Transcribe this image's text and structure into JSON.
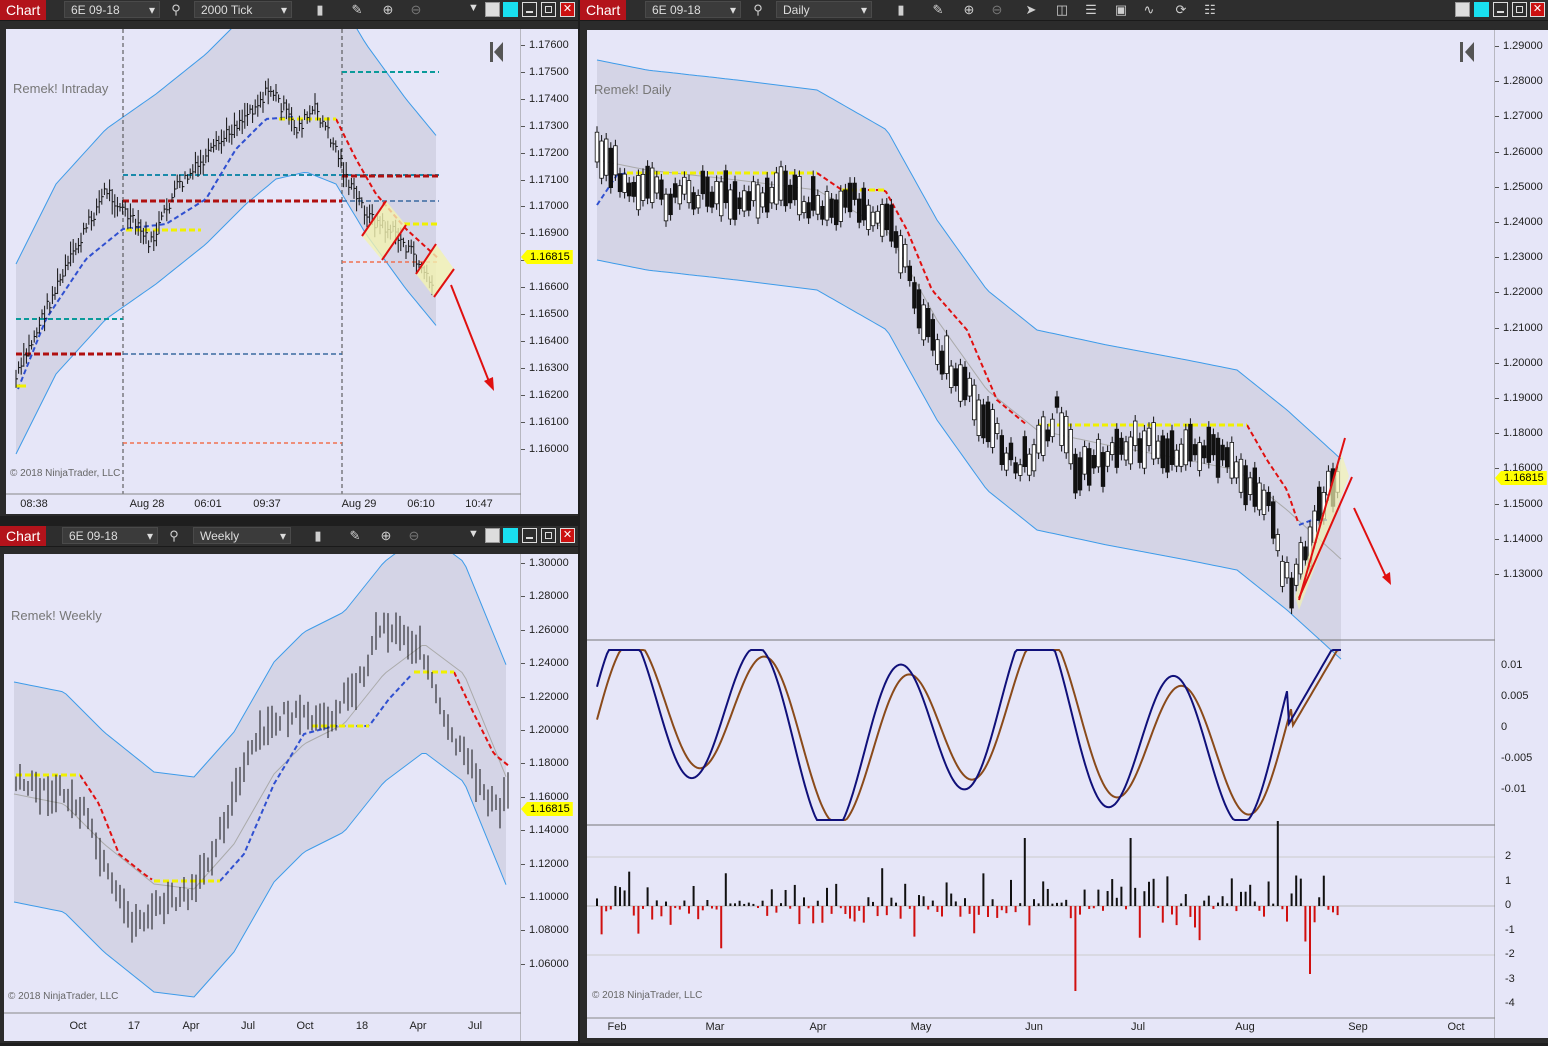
{
  "windows": {
    "intraday": {
      "tab_label": "Chart",
      "instrument": "6E 09-18",
      "period": "2000 Tick",
      "chart_label": "Remek! Intraday",
      "copyright": "© 2018 NinjaTrader, LLC",
      "price_badge": "1.16815",
      "price_ticks": [
        "1.17600",
        "1.17500",
        "1.17400",
        "1.17300",
        "1.17200",
        "1.17100",
        "1.17000",
        "1.16900",
        "1.16815",
        "1.16700",
        "1.16600",
        "1.16500",
        "1.16400",
        "1.16300",
        "1.16200",
        "1.16100",
        "1.16000"
      ],
      "time_ticks": [
        "08:38",
        "Aug 28",
        "06:01",
        "09:37",
        "Aug 29",
        "06:10",
        "10:47"
      ]
    },
    "weekly": {
      "tab_label": "Chart",
      "instrument": "6E 09-18",
      "period": "Weekly",
      "chart_label": "Remek! Weekly",
      "copyright": "© 2018 NinjaTrader, LLC",
      "price_badge": "1.16815",
      "price_ticks": [
        "1.30000",
        "1.28000",
        "1.26000",
        "1.24000",
        "1.22000",
        "1.20000",
        "1.18000",
        "1.16000",
        "1.14000",
        "1.12000",
        "1.10000",
        "1.08000",
        "1.06000"
      ],
      "time_ticks": [
        "Oct",
        "17",
        "Apr",
        "Jul",
        "Oct",
        "18",
        "Apr",
        "Jul"
      ]
    },
    "daily": {
      "tab_label": "Chart",
      "instrument": "6E 09-18",
      "period": "Daily",
      "chart_label": "Remek! Daily",
      "copyright": "© 2018 NinjaTrader, LLC",
      "price_badge": "1.16815",
      "price_ticks": [
        "1.29000",
        "1.28000",
        "1.27000",
        "1.26000",
        "1.25000",
        "1.24000",
        "1.23000",
        "1.22000",
        "1.21000",
        "1.20000",
        "1.19000",
        "1.18000",
        "1.16000",
        "1.15000",
        "1.14000",
        "1.13000"
      ],
      "osc_ticks": [
        "0.01",
        "0.005",
        "0",
        "-0.005",
        "-0.01"
      ],
      "hist_ticks": [
        "2",
        "1",
        "0",
        "-1",
        "-2",
        "-3",
        "-4"
      ],
      "time_ticks": [
        "Feb",
        "Mar",
        "Apr",
        "May",
        "Jun",
        "Jul",
        "Aug",
        "Sep",
        "Oct"
      ]
    }
  },
  "colors": {
    "tab_red": "#b3131b",
    "plot_bg": "#e6e6f8",
    "band": "#3d9be9",
    "up_trend": "#3050d0",
    "down_trend": "#e01010",
    "neutral": "#f0f000",
    "badge": "#ffff00"
  },
  "icons": [
    "search-icon",
    "bar-style-icon",
    "pencil-icon",
    "zoom-in-icon",
    "zoom-out-icon",
    "pointer-icon",
    "data-box-icon",
    "indicators-icon",
    "strategies-icon",
    "drawing-tools-icon",
    "reload-icon",
    "properties-icon"
  ]
}
